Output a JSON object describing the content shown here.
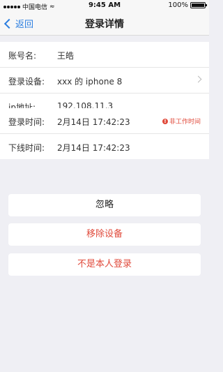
{
  "status_bar": {
    "carrier": "中国电信",
    "time": "9:45 AM",
    "battery": "100%"
  },
  "nav": {
    "back_label": "返回",
    "title": "登录详情"
  },
  "account_info": [
    {
      "label": "账号名:",
      "value": "王皓"
    },
    {
      "label": "登录设备:",
      "value": "xxx 的 iphone 8"
    },
    {
      "label": "ip地址:",
      "value": "192.108.11.3"
    }
  ],
  "login_info": [
    {
      "label": "登录时间:",
      "value": "2月14日 17:42:23",
      "badge": "非工作时间"
    },
    {
      "label": "下线时间:",
      "value": "2月14日 17:42:23"
    }
  ],
  "actions": {
    "ignore": "忽略",
    "remove_device": "移除设备",
    "not_me": "不是本人登录"
  },
  "colors": {
    "accent": "#2b7ee0",
    "danger": "#e04a3b"
  }
}
